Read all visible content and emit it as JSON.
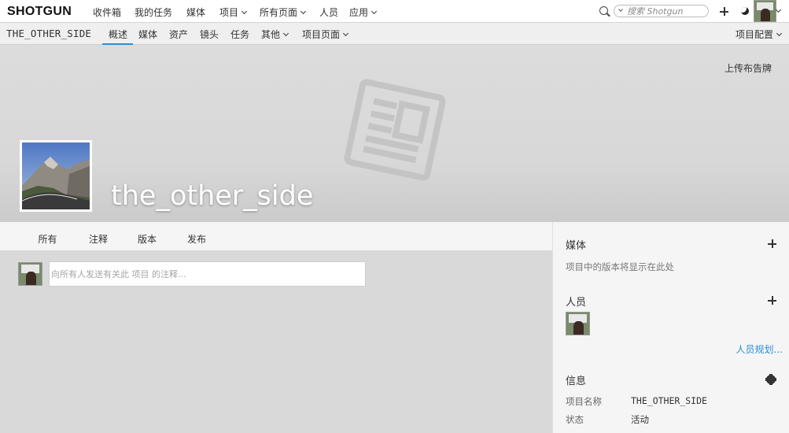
{
  "app": {
    "logo": "SHOTGUN"
  },
  "topnav": {
    "items": [
      "收件箱",
      "我的任务",
      "媒体",
      "项目",
      "所有页面",
      "人员",
      "应用"
    ],
    "search_placeholder": "搜索 Shotgun"
  },
  "project": {
    "name": "THE_OTHER_SIDE",
    "tabs": [
      "概述",
      "媒体",
      "资产",
      "镜头",
      "任务",
      "其他",
      "项目页面"
    ],
    "active_tab": "概述",
    "config_label": "项目配置"
  },
  "banner": {
    "upload_label": "上传布告牌",
    "title": "the_other_side"
  },
  "activity": {
    "tabs": [
      "所有",
      "注释",
      "版本",
      "发布"
    ],
    "active_tab": "所有",
    "note_placeholder": "向所有人发送有关此 项目 的注释..."
  },
  "sidebar": {
    "media_title": "媒体",
    "media_empty": "项目中的版本将显示在此处",
    "people_title": "人员",
    "people_link": "人员规划...",
    "info_title": "信息",
    "info_rows": [
      {
        "label": "项目名称",
        "value": "THE_OTHER_SIDE"
      },
      {
        "label": "状态",
        "value": "活动"
      }
    ]
  },
  "colors": {
    "accent": "#2b8fd6"
  }
}
